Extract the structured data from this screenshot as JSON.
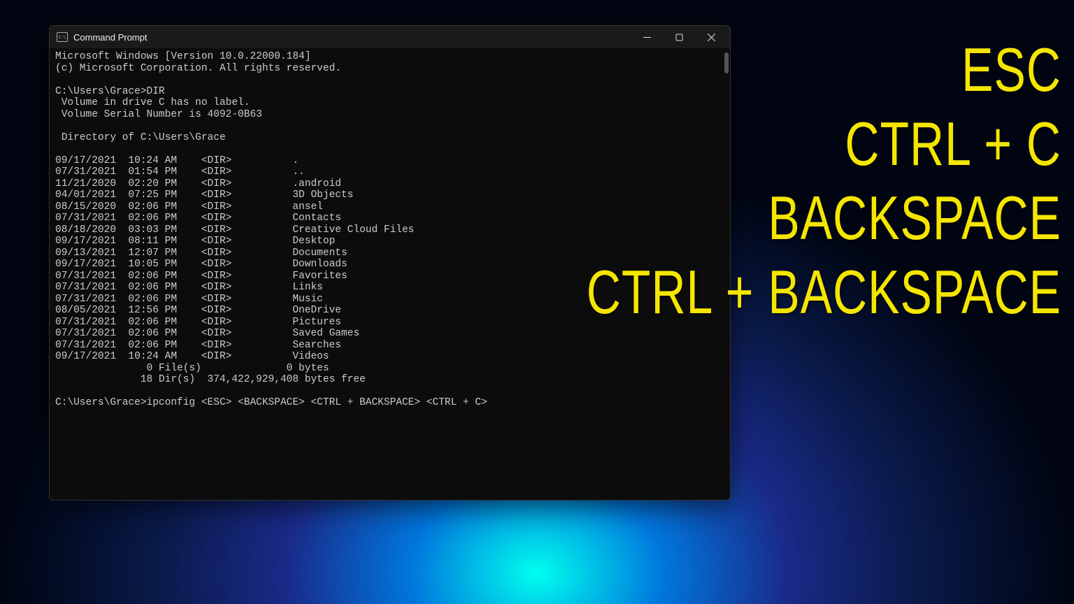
{
  "window": {
    "title": "Command Prompt"
  },
  "terminal": {
    "header_line1": "Microsoft Windows [Version 10.0.22000.184]",
    "header_line2": "(c) Microsoft Corporation. All rights reserved.",
    "prompt1": "C:\\Users\\Grace>DIR",
    "vol_line1": " Volume in drive C has no label.",
    "vol_line2": " Volume Serial Number is 4092-0B63",
    "dir_header": " Directory of C:\\Users\\Grace",
    "rows": [
      {
        "date": "09/17/2021",
        "time": "10:24 AM",
        "type": "<DIR>",
        "name": "."
      },
      {
        "date": "07/31/2021",
        "time": "01:54 PM",
        "type": "<DIR>",
        "name": ".."
      },
      {
        "date": "11/21/2020",
        "time": "02:20 PM",
        "type": "<DIR>",
        "name": ".android"
      },
      {
        "date": "04/01/2021",
        "time": "07:25 PM",
        "type": "<DIR>",
        "name": "3D Objects"
      },
      {
        "date": "08/15/2020",
        "time": "02:06 PM",
        "type": "<DIR>",
        "name": "ansel"
      },
      {
        "date": "07/31/2021",
        "time": "02:06 PM",
        "type": "<DIR>",
        "name": "Contacts"
      },
      {
        "date": "08/18/2020",
        "time": "03:03 PM",
        "type": "<DIR>",
        "name": "Creative Cloud Files"
      },
      {
        "date": "09/17/2021",
        "time": "08:11 PM",
        "type": "<DIR>",
        "name": "Desktop"
      },
      {
        "date": "09/13/2021",
        "time": "12:07 PM",
        "type": "<DIR>",
        "name": "Documents"
      },
      {
        "date": "09/17/2021",
        "time": "10:05 PM",
        "type": "<DIR>",
        "name": "Downloads"
      },
      {
        "date": "07/31/2021",
        "time": "02:06 PM",
        "type": "<DIR>",
        "name": "Favorites"
      },
      {
        "date": "07/31/2021",
        "time": "02:06 PM",
        "type": "<DIR>",
        "name": "Links"
      },
      {
        "date": "07/31/2021",
        "time": "02:06 PM",
        "type": "<DIR>",
        "name": "Music"
      },
      {
        "date": "08/05/2021",
        "time": "12:56 PM",
        "type": "<DIR>",
        "name": "OneDrive"
      },
      {
        "date": "07/31/2021",
        "time": "02:06 PM",
        "type": "<DIR>",
        "name": "Pictures"
      },
      {
        "date": "07/31/2021",
        "time": "02:06 PM",
        "type": "<DIR>",
        "name": "Saved Games"
      },
      {
        "date": "07/31/2021",
        "time": "02:06 PM",
        "type": "<DIR>",
        "name": "Searches"
      },
      {
        "date": "09/17/2021",
        "time": "10:24 AM",
        "type": "<DIR>",
        "name": "Videos"
      }
    ],
    "summary_line1": "               0 File(s)              0 bytes",
    "summary_line2": "              18 Dir(s)  374,422,929,408 bytes free",
    "prompt2": "C:\\Users\\Grace>ipconfig <ESC> <BACKSPACE> <CTRL + BACKSPACE> <CTRL + C>"
  },
  "overlay": {
    "labels": [
      "ESC",
      "CTRL + C",
      "BACKSPACE",
      "CTRL + BACKSPACE"
    ]
  }
}
